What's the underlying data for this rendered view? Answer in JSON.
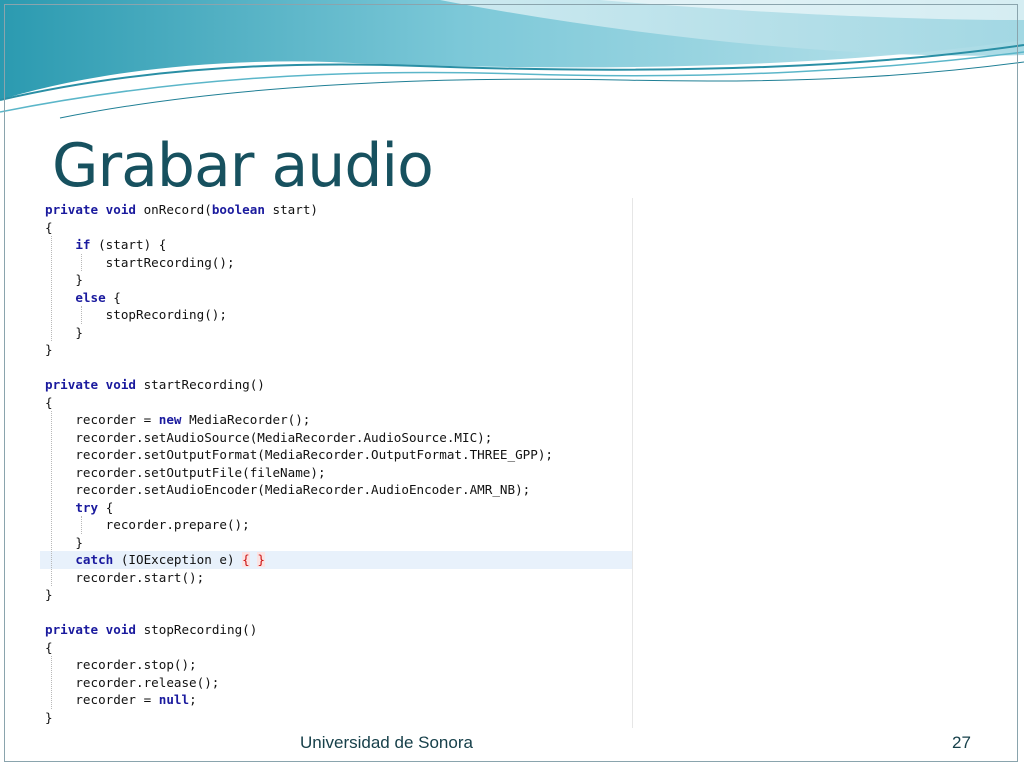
{
  "slide": {
    "title": "Grabar audio",
    "footer": "Universidad de Sonora",
    "page_number": "27",
    "colors": {
      "title": "#17515f",
      "wave_dark": "#2b9ab0",
      "wave_light": "#bfe4ec",
      "keyword": "#1a1a9e",
      "highlight_line": "#e8f1fb",
      "matched_brace": "#cc1111"
    }
  },
  "code": {
    "lines": [
      {
        "tokens": [
          {
            "t": "private void ",
            "k": "kw"
          },
          {
            "t": "onRecord(",
            "k": "id"
          },
          {
            "t": "boolean ",
            "k": "kw"
          },
          {
            "t": "start)",
            "k": "id"
          }
        ]
      },
      {
        "tokens": [
          {
            "t": "{",
            "k": "id"
          }
        ]
      },
      {
        "tokens": [
          {
            "t": "    ",
            "k": "id"
          },
          {
            "t": "if ",
            "k": "kw"
          },
          {
            "t": "(start) {",
            "k": "id"
          }
        ]
      },
      {
        "tokens": [
          {
            "t": "        startRecording();",
            "k": "id"
          }
        ]
      },
      {
        "tokens": [
          {
            "t": "    }",
            "k": "id"
          }
        ]
      },
      {
        "tokens": [
          {
            "t": "    ",
            "k": "id"
          },
          {
            "t": "else ",
            "k": "kw"
          },
          {
            "t": "{",
            "k": "id"
          }
        ]
      },
      {
        "tokens": [
          {
            "t": "        stopRecording();",
            "k": "id"
          }
        ]
      },
      {
        "tokens": [
          {
            "t": "    }",
            "k": "id"
          }
        ]
      },
      {
        "tokens": [
          {
            "t": "}",
            "k": "id"
          }
        ]
      },
      {
        "tokens": []
      },
      {
        "tokens": [
          {
            "t": "private void ",
            "k": "kw"
          },
          {
            "t": "startRecording()",
            "k": "id"
          }
        ]
      },
      {
        "tokens": [
          {
            "t": "{",
            "k": "id"
          }
        ]
      },
      {
        "tokens": [
          {
            "t": "    recorder = ",
            "k": "id"
          },
          {
            "t": "new ",
            "k": "kw"
          },
          {
            "t": "MediaRecorder();",
            "k": "id"
          }
        ]
      },
      {
        "tokens": [
          {
            "t": "    recorder.setAudioSource(MediaRecorder.AudioSource.MIC);",
            "k": "id"
          }
        ]
      },
      {
        "tokens": [
          {
            "t": "    recorder.setOutputFormat(MediaRecorder.OutputFormat.THREE_GPP);",
            "k": "id"
          }
        ]
      },
      {
        "tokens": [
          {
            "t": "    recorder.setOutputFile(fileName);",
            "k": "id"
          }
        ]
      },
      {
        "tokens": [
          {
            "t": "    recorder.setAudioEncoder(MediaRecorder.AudioEncoder.AMR_NB);",
            "k": "id"
          }
        ]
      },
      {
        "tokens": [
          {
            "t": "    ",
            "k": "id"
          },
          {
            "t": "try ",
            "k": "kw"
          },
          {
            "t": "{",
            "k": "id"
          }
        ]
      },
      {
        "tokens": [
          {
            "t": "        recorder.prepare();",
            "k": "id"
          }
        ]
      },
      {
        "tokens": [
          {
            "t": "    }",
            "k": "id"
          }
        ]
      },
      {
        "highlight": true,
        "tokens": [
          {
            "t": "    ",
            "k": "id"
          },
          {
            "t": "catch ",
            "k": "kw"
          },
          {
            "t": "(IOException e) ",
            "k": "id"
          },
          {
            "t": "{",
            "k": "br"
          },
          {
            "t": " ",
            "k": "id"
          },
          {
            "t": "}",
            "k": "br"
          }
        ]
      },
      {
        "tokens": [
          {
            "t": "    recorder.start();",
            "k": "id"
          }
        ]
      },
      {
        "tokens": [
          {
            "t": "}",
            "k": "id"
          }
        ]
      },
      {
        "tokens": []
      },
      {
        "tokens": [
          {
            "t": "private void ",
            "k": "kw"
          },
          {
            "t": "stopRecording()",
            "k": "id"
          }
        ]
      },
      {
        "tokens": [
          {
            "t": "{",
            "k": "id"
          }
        ]
      },
      {
        "tokens": [
          {
            "t": "    recorder.stop();",
            "k": "id"
          }
        ]
      },
      {
        "tokens": [
          {
            "t": "    recorder.release();",
            "k": "id"
          }
        ]
      },
      {
        "tokens": [
          {
            "t": "    recorder = ",
            "k": "id"
          },
          {
            "t": "null",
            "k": "kw"
          },
          {
            "t": ";",
            "k": "id"
          }
        ]
      },
      {
        "tokens": [
          {
            "t": "}",
            "k": "id"
          }
        ]
      }
    ]
  }
}
